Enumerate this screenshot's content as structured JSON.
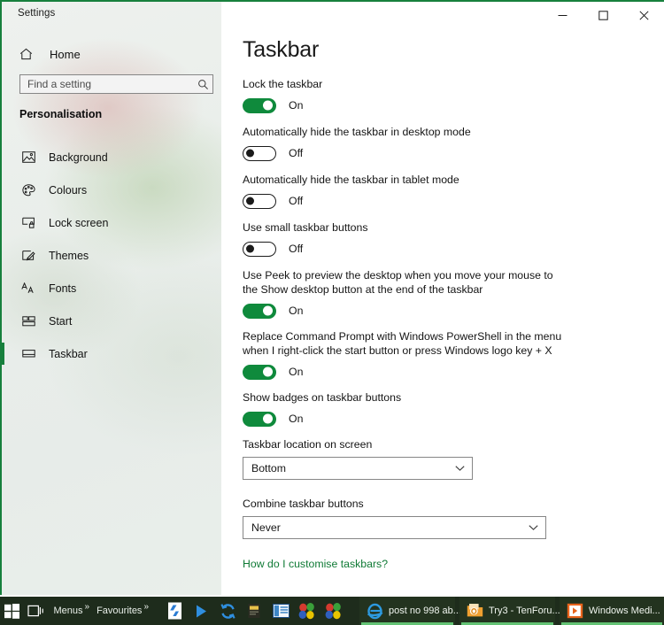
{
  "window": {
    "title": "Settings",
    "accent_color": "#17803d",
    "controls": {
      "minimize": "minimize-icon",
      "maximize": "maximize-icon",
      "close": "close-icon"
    }
  },
  "sidebar": {
    "home_label": "Home",
    "home_icon": "home-icon",
    "search": {
      "placeholder": "Find a setting",
      "value": "",
      "icon": "search-icon"
    },
    "section_title": "Personalisation",
    "items": [
      {
        "label": "Background",
        "icon": "image-icon",
        "selected": false
      },
      {
        "label": "Colours",
        "icon": "palette-icon",
        "selected": false
      },
      {
        "label": "Lock screen",
        "icon": "lock-screen-icon",
        "selected": false
      },
      {
        "label": "Themes",
        "icon": "themes-brush-icon",
        "selected": false
      },
      {
        "label": "Fonts",
        "icon": "fonts-aa-icon",
        "selected": false
      },
      {
        "label": "Start",
        "icon": "start-tiles-icon",
        "selected": false
      },
      {
        "label": "Taskbar",
        "icon": "taskbar-icon",
        "selected": true
      }
    ]
  },
  "main": {
    "page_title": "Taskbar",
    "settings": [
      {
        "label": "Lock the taskbar",
        "control": "toggle",
        "state": "On"
      },
      {
        "label": "Automatically hide the taskbar in desktop mode",
        "control": "toggle",
        "state": "Off"
      },
      {
        "label": "Automatically hide the taskbar in tablet mode",
        "control": "toggle",
        "state": "Off"
      },
      {
        "label": "Use small taskbar buttons",
        "control": "toggle",
        "state": "Off"
      },
      {
        "label": "Use Peek to preview the desktop when you move your mouse to\nthe Show desktop button at the end of the taskbar",
        "control": "toggle",
        "state": "On"
      },
      {
        "label": "Replace Command Prompt with Windows PowerShell in the menu\nwhen I right-click the start button or press Windows logo key + X",
        "control": "toggle",
        "state": "On"
      },
      {
        "label": "Show badges on taskbar buttons",
        "control": "toggle",
        "state": "On"
      },
      {
        "label": "Taskbar location on screen",
        "control": "dropdown",
        "value": "Bottom"
      },
      {
        "label": "Combine taskbar buttons",
        "control": "dropdown",
        "value": "Never"
      }
    ],
    "help_link": "How do I customise taskbars?",
    "help_link_color": "#0f7a35"
  },
  "taskbar": {
    "background_color": "#1e2c1c",
    "start_icon": "windows-start-icon",
    "task_view_icon": "task-view-icon",
    "toolbars": [
      {
        "label": "Menus",
        "chevron": "»"
      },
      {
        "label": "Favourites",
        "chevron": "»"
      }
    ],
    "pinned_icons": [
      "document-blue-icon",
      "play-triangle-icon",
      "sync-refresh-icon",
      "folder-card-icon",
      "book-panel-icon",
      "balloons-colour-icon",
      "balloons-colour-icon-2"
    ],
    "windows": [
      {
        "icon": "internet-explorer-icon",
        "label": "post no 998 ab..."
      },
      {
        "icon": "outlook-folder-icon",
        "label": "Try3 - TenForu..."
      },
      {
        "icon": "windows-media-player-icon",
        "label": "Windows Medi..."
      }
    ],
    "active_underline_color": "#63c374"
  }
}
